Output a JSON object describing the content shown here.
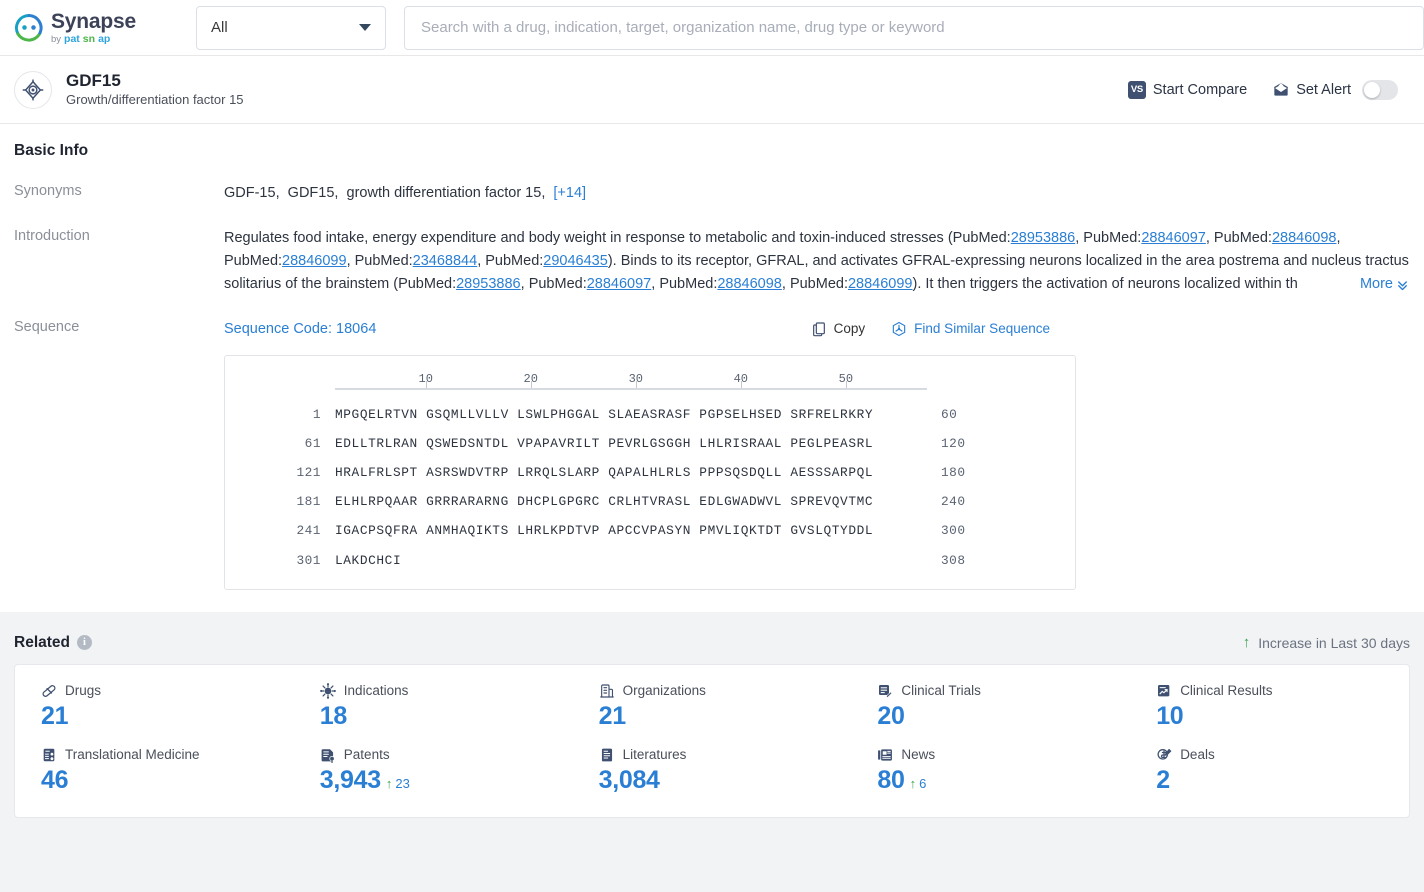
{
  "brand": {
    "name": "Synapse",
    "by": "by",
    "sub_parts": [
      "pat",
      "sn",
      "ap"
    ],
    "colors": {
      "teal": "#2fa4dd",
      "green": "#4cb648",
      "accent": "#2a7fd4"
    }
  },
  "search": {
    "scope_value": "All",
    "placeholder": "Search with a drug, indication, target, organization name, drug type or keyword",
    "value": ""
  },
  "entity": {
    "icon": "target-icon",
    "title": "GDF15",
    "subtitle": "Growth/differentiation factor 15",
    "actions": {
      "compare_label": "Start Compare",
      "compare_badge": "VS",
      "alert_label": "Set Alert",
      "alert_on": false
    }
  },
  "basic_info": {
    "section_title": "Basic Info",
    "synonyms": {
      "label": "Synonyms",
      "values": [
        "GDF-15",
        "GDF15",
        "growth differentiation factor 15"
      ],
      "more_count": "[+14]"
    },
    "introduction": {
      "label": "Introduction",
      "more_label": "More",
      "line1_a": "Regulates food intake, energy expenditure and body weight in response to metabolic and toxin-induced stresses (PubMed:",
      "line1_ids": [
        "28953886",
        "28846097",
        "28846098"
      ],
      "line2_ids": [
        "28846099",
        "23468844",
        "29046435"
      ],
      "line2_b": "). Binds to its receptor, GFRAL, and activates GFRAL-expressing neurons localized in the area postrema and nucleus",
      "line3_a": "tractus solitarius of the brainstem (PubMed:",
      "line3_ids": [
        "28953886",
        "28846097",
        "28846098",
        "28846099"
      ],
      "line3_b": "). It then triggers the activation of neurons localized within th",
      "pubmed_prefix": "PubMed:"
    },
    "sequence": {
      "label": "Sequence",
      "code_label": "Sequence Code: 18064",
      "copy_label": "Copy",
      "find_label": "Find Similar Sequence",
      "ruler_ticks": [
        10,
        20,
        30,
        40,
        50
      ],
      "lines": [
        {
          "start": "1",
          "chunks": [
            "MPGQELRTVN",
            "GSQMLLVLLV",
            "LSWLPHGGAL",
            "SLAEASRASF",
            "PGPSELHSED",
            "SRFRELRKRY"
          ],
          "end": "60"
        },
        {
          "start": "61",
          "chunks": [
            "EDLLTRLRAN",
            "QSWEDSNTDL",
            "VPAPAVRILT",
            "PEVRLGSGGH",
            "LHLRISRAAL",
            "PEGLPEASRL"
          ],
          "end": "120"
        },
        {
          "start": "121",
          "chunks": [
            "HRALFRLSPT",
            "ASRSWDVTRP",
            "LRRQLSLARP",
            "QAPALHLRLS",
            "PPPSQSDQLL",
            "AESSSARPQL"
          ],
          "end": "180"
        },
        {
          "start": "181",
          "chunks": [
            "ELHLRPQAAR",
            "GRRRARARNG",
            "DHCPLGPGRC",
            "CRLHTVRASL",
            "EDLGWADWVL",
            "SPREVQVTMC"
          ],
          "end": "240"
        },
        {
          "start": "241",
          "chunks": [
            "IGACPSQFRA",
            "ANMHAQIKTS",
            "LHRLKPDTVP",
            "APCCVPASYN",
            "PMVLIQKTDT",
            "GVSLQTYDDL"
          ],
          "end": "300"
        },
        {
          "start": "301",
          "chunks": [
            "LAKDCHCI"
          ],
          "end": "308"
        }
      ]
    }
  },
  "related": {
    "title": "Related",
    "info_icon": "info-icon",
    "increase_note": "Increase in Last 30 days",
    "stats": [
      {
        "icon": "pill-icon",
        "label": "Drugs",
        "value": "21",
        "delta": null
      },
      {
        "icon": "virus-icon",
        "label": "Indications",
        "value": "18",
        "delta": null
      },
      {
        "icon": "building-icon",
        "label": "Organizations",
        "value": "21",
        "delta": null
      },
      {
        "icon": "clinical-trial-icon",
        "label": "Clinical Trials",
        "value": "20",
        "delta": null
      },
      {
        "icon": "clinical-result-icon",
        "label": "Clinical Results",
        "value": "10",
        "delta": null
      },
      {
        "icon": "translational-icon",
        "label": "Translational Medicine",
        "value": "46",
        "delta": null
      },
      {
        "icon": "patent-icon",
        "label": "Patents",
        "value": "3,943",
        "delta": "23"
      },
      {
        "icon": "literature-icon",
        "label": "Literatures",
        "value": "3,084",
        "delta": null
      },
      {
        "icon": "news-icon",
        "label": "News",
        "value": "80",
        "delta": "6"
      },
      {
        "icon": "deal-icon",
        "label": "Deals",
        "value": "2",
        "delta": null
      }
    ]
  }
}
